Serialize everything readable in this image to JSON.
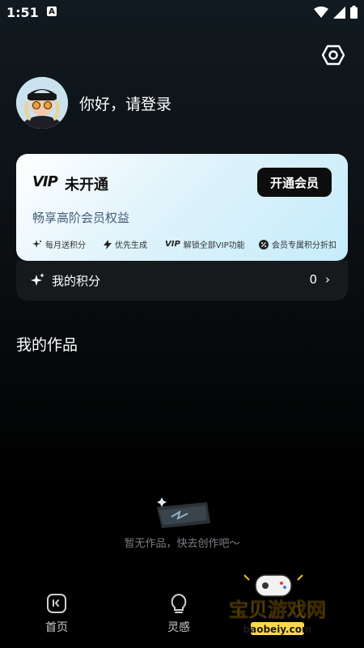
{
  "status_bar": {
    "time": "1:51",
    "notif_icon": "A"
  },
  "profile": {
    "greeting": "你好，请登录"
  },
  "vip": {
    "logo": "VIP",
    "status": "未开通",
    "open_button": "开通会员",
    "subtitle": "畅享高阶会员权益",
    "benefits": [
      {
        "icon": "sparkle-icon",
        "label": "每月送积分"
      },
      {
        "icon": "lightning-icon",
        "label": "优先生成"
      },
      {
        "icon": "vip-icon",
        "label": "解锁全部VIP功能"
      },
      {
        "icon": "discount-icon",
        "label": "会员专属积分折扣"
      }
    ]
  },
  "points": {
    "label": "我的积分",
    "value": "0"
  },
  "works": {
    "title": "我的作品",
    "empty_text": "暂无作品，快去创作吧～"
  },
  "bottom_nav": [
    {
      "label": "首页",
      "icon": "home-icon"
    },
    {
      "label": "灵感",
      "icon": "bulb-icon"
    }
  ],
  "watermark": {
    "title": "宝贝游戏网",
    "url": "baobeiy.com"
  },
  "colors": {
    "vip_card_start": "#ffffff",
    "vip_card_end": "#c5ecfb",
    "button_dark": "#0d0d0d",
    "muted_text": "#7b7f84"
  }
}
